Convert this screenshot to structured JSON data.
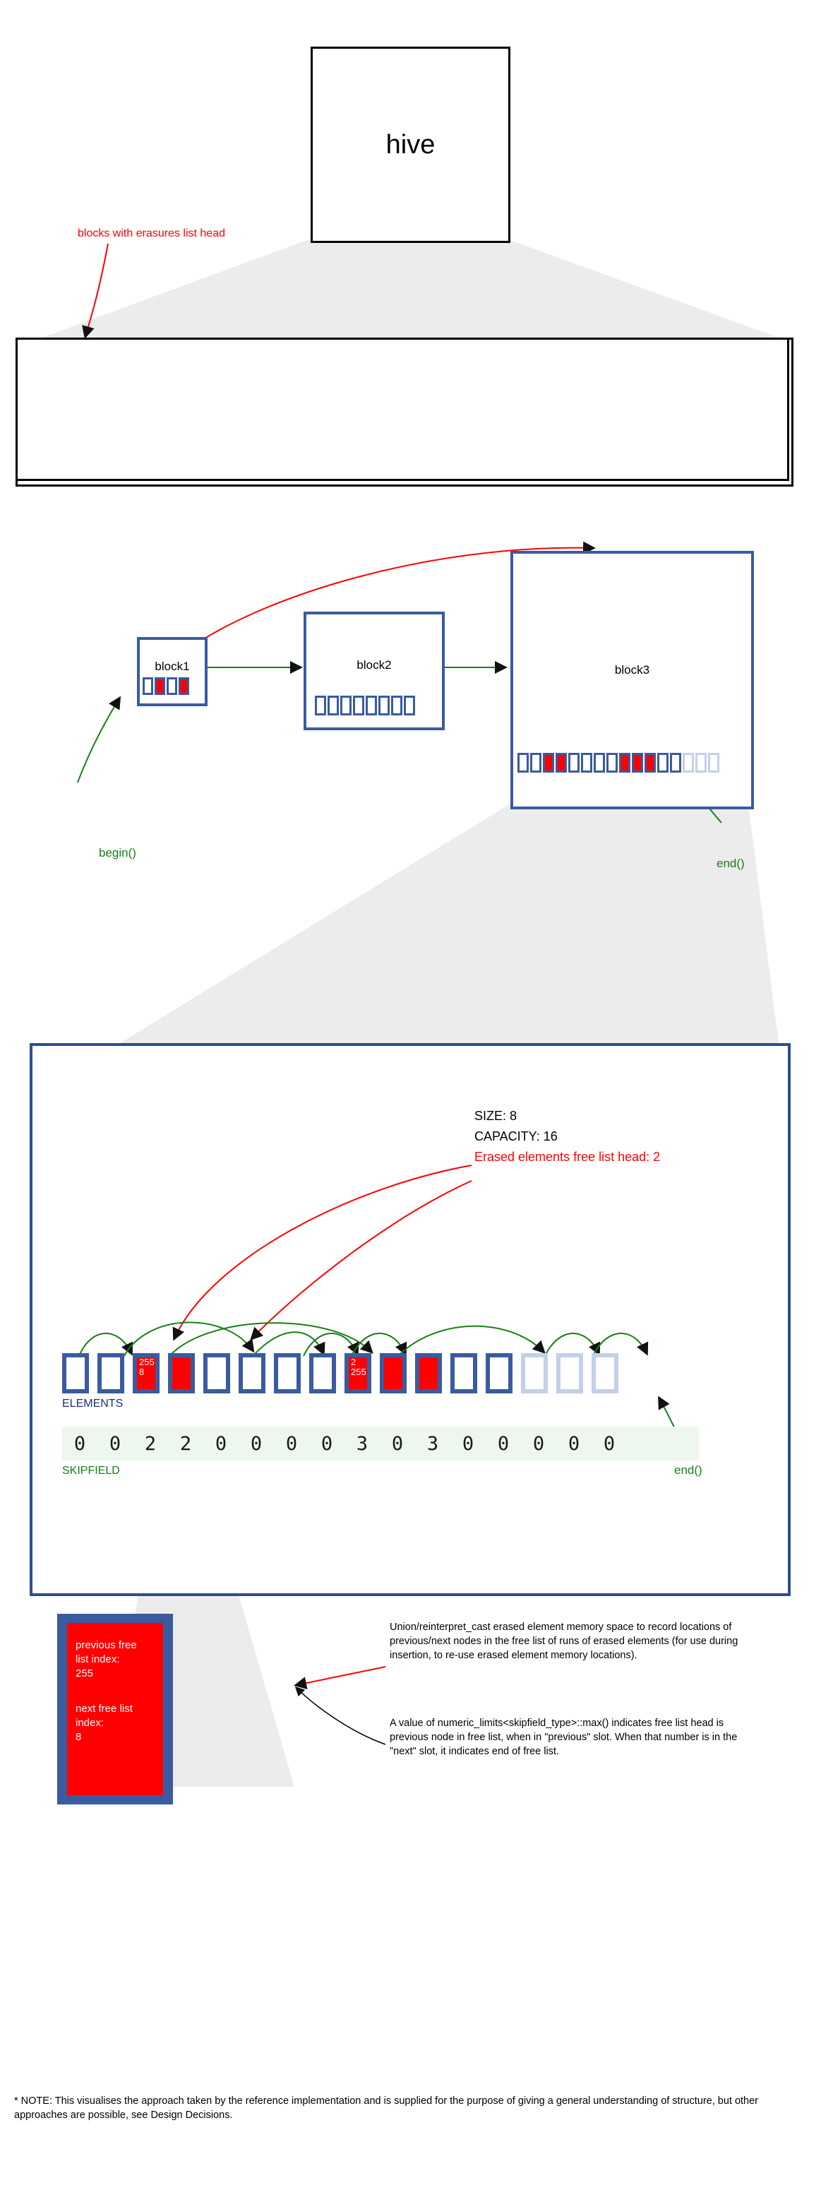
{
  "title_box": {
    "label": "hive"
  },
  "panel_blocks": {
    "annotation_red": "blocks with erasures list head",
    "begin_label": "begin()",
    "end_label": "end()",
    "blocks": [
      {
        "name": "block1",
        "capacity": 4,
        "cells": [
          "empty",
          "erased",
          "empty",
          "erased"
        ]
      },
      {
        "name": "block2",
        "capacity": 8,
        "cells": [
          "empty",
          "empty",
          "empty",
          "empty",
          "empty",
          "empty",
          "empty",
          "empty"
        ]
      },
      {
        "name": "block3",
        "capacity": 16,
        "cells": [
          "empty",
          "empty",
          "erased",
          "erased",
          "empty",
          "empty",
          "empty",
          "empty",
          "erased",
          "erased",
          "erased",
          "empty",
          "empty",
          "unused",
          "unused",
          "unused"
        ]
      }
    ]
  },
  "panel_block_detail": {
    "stats": [
      "SIZE: 8",
      "CAPACITY: 16"
    ],
    "free_list_head_label": "Erased elements free list head: 2",
    "elements_label": "ELEMENTS",
    "skipfield_label": "SKIPFIELD",
    "end_label": "end()",
    "elements": [
      {
        "state": "empty",
        "prev": "",
        "next": ""
      },
      {
        "state": "empty",
        "prev": "",
        "next": ""
      },
      {
        "state": "erased",
        "prev": "255",
        "next": "8"
      },
      {
        "state": "erased",
        "prev": "",
        "next": ""
      },
      {
        "state": "empty",
        "prev": "",
        "next": ""
      },
      {
        "state": "empty",
        "prev": "",
        "next": ""
      },
      {
        "state": "empty",
        "prev": "",
        "next": ""
      },
      {
        "state": "empty",
        "prev": "",
        "next": ""
      },
      {
        "state": "erased",
        "prev": "2",
        "next": "255"
      },
      {
        "state": "erased",
        "prev": "",
        "next": ""
      },
      {
        "state": "erased",
        "prev": "",
        "next": ""
      },
      {
        "state": "empty",
        "prev": "",
        "next": ""
      },
      {
        "state": "empty",
        "prev": "",
        "next": ""
      },
      {
        "state": "unused",
        "prev": "",
        "next": ""
      },
      {
        "state": "unused",
        "prev": "",
        "next": ""
      },
      {
        "state": "unused",
        "prev": "",
        "next": ""
      }
    ],
    "skipfield": [
      "0",
      "0",
      "2",
      "2",
      "0",
      "0",
      "0",
      "0",
      "3",
      "0",
      "3",
      "0",
      "0",
      "0",
      "0",
      "0"
    ]
  },
  "panel_element_detail": {
    "prev_label": "previous free\nlist index:",
    "prev_value": "255",
    "next_label": "next free list\nindex:",
    "next_value": "8",
    "note_union": "Union/reinterpret_cast erased element memory space to record locations of previous/next nodes in the free list of runs of erased elements (for use during insertion, to re-use erased element memory locations).",
    "note_max": "A value of numeric_limits<skipfield_type>::max() indicates free list head is previous node in free list, when in \"previous\" slot. When that number is in the \"next\" slot, it indicates end of free list."
  },
  "footnote": "* NOTE: This visualises the approach taken by the reference implementation and is supplied for the purpose of giving a general understanding of structure, but other approaches are possible, see Design Decisions.",
  "colors": {
    "erased": "#fe0000",
    "block_border": "#3a5ba0",
    "panel_border": "#2e4d8f",
    "annotation_red": "#ff0000",
    "annotation_green": "#168016",
    "wedge": "#ececec"
  }
}
